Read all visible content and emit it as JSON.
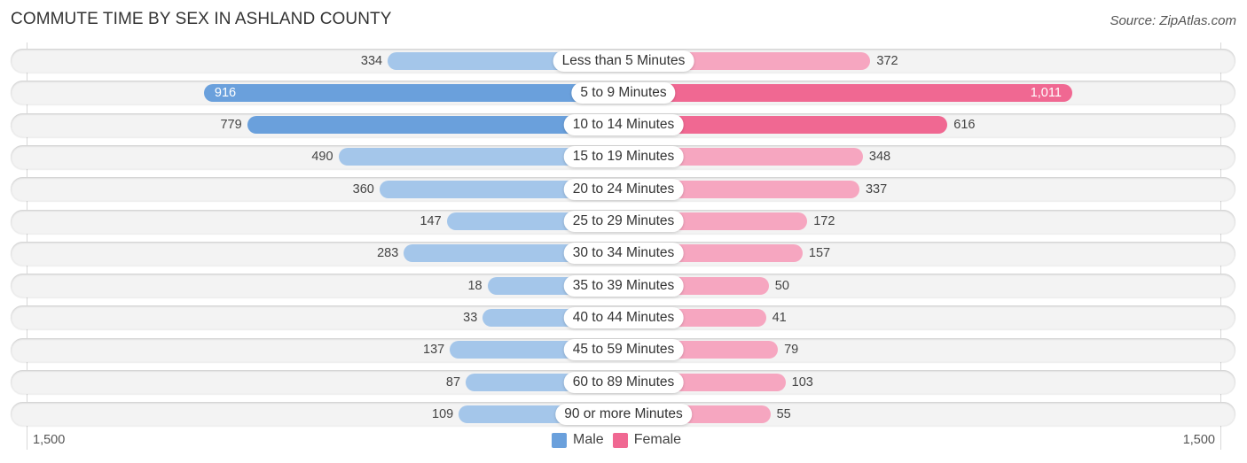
{
  "title": "COMMUTE TIME BY SEX IN ASHLAND COUNTY",
  "source": "Source: ZipAtlas.com",
  "colors": {
    "male": "#6aa0dc",
    "male_light": "#a4c6ea",
    "female": "#f06892",
    "female_light": "#f6a6c0"
  },
  "chart_data": {
    "type": "bar",
    "orientation": "horizontal-diverging",
    "title": "COMMUTE TIME BY SEX IN ASHLAND COUNTY",
    "categories": [
      "Less than 5 Minutes",
      "5 to 9 Minutes",
      "10 to 14 Minutes",
      "15 to 19 Minutes",
      "20 to 24 Minutes",
      "25 to 29 Minutes",
      "30 to 34 Minutes",
      "35 to 39 Minutes",
      "40 to 44 Minutes",
      "45 to 59 Minutes",
      "60 to 89 Minutes",
      "90 or more Minutes"
    ],
    "series": [
      {
        "name": "Male",
        "values": [
          334,
          916,
          779,
          490,
          360,
          147,
          283,
          18,
          33,
          137,
          87,
          109
        ]
      },
      {
        "name": "Female",
        "values": [
          372,
          1011,
          616,
          348,
          337,
          172,
          157,
          50,
          41,
          79,
          103,
          55
        ]
      }
    ],
    "value_labels": {
      "male": [
        "334",
        "916",
        "779",
        "490",
        "360",
        "147",
        "283",
        "18",
        "33",
        "137",
        "87",
        "109"
      ],
      "female": [
        "372",
        "1,011",
        "616",
        "348",
        "337",
        "172",
        "157",
        "50",
        "41",
        "79",
        "103",
        "55"
      ]
    },
    "axis": {
      "min_label": "1,500",
      "max_label": "1,500",
      "range": [
        0,
        1500
      ]
    },
    "legend": {
      "position": "bottom-center",
      "items": [
        "Male",
        "Female"
      ]
    }
  }
}
